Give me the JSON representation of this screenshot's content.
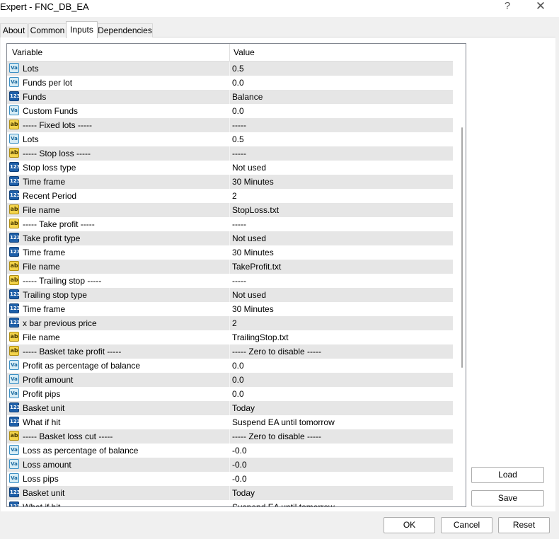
{
  "window": {
    "title": "Expert - FNC_DB_EA",
    "help": "?",
    "close": "✕"
  },
  "tabs": [
    {
      "label": "About"
    },
    {
      "label": "Common"
    },
    {
      "label": "Inputs"
    },
    {
      "label": "Dependencies"
    }
  ],
  "grid": {
    "headers": {
      "variable": "Variable",
      "value": "Value"
    },
    "rows": [
      {
        "type": "v",
        "variable": "Lots",
        "value": "0.5"
      },
      {
        "type": "v",
        "variable": "Funds per lot",
        "value": "0.0"
      },
      {
        "type": "n",
        "variable": "Funds",
        "value": "Balance"
      },
      {
        "type": "v",
        "variable": "Custom Funds",
        "value": "0.0"
      },
      {
        "type": "s",
        "variable": "----- Fixed lots -----",
        "value": "-----"
      },
      {
        "type": "v",
        "variable": "Lots",
        "value": "0.5"
      },
      {
        "type": "s",
        "variable": "----- Stop loss -----",
        "value": "-----"
      },
      {
        "type": "n",
        "variable": "Stop loss type",
        "value": "Not used"
      },
      {
        "type": "n",
        "variable": "Time frame",
        "value": "30 Minutes"
      },
      {
        "type": "n",
        "variable": "Recent Period",
        "value": "2"
      },
      {
        "type": "s",
        "variable": "File name",
        "value": "StopLoss.txt"
      },
      {
        "type": "s",
        "variable": "----- Take profit -----",
        "value": "-----"
      },
      {
        "type": "n",
        "variable": "Take profit type",
        "value": "Not used"
      },
      {
        "type": "n",
        "variable": "Time frame",
        "value": "30 Minutes"
      },
      {
        "type": "s",
        "variable": "File name",
        "value": "TakeProfit.txt"
      },
      {
        "type": "s",
        "variable": "----- Trailing stop -----",
        "value": "-----"
      },
      {
        "type": "n",
        "variable": "Trailing stop type",
        "value": "Not used"
      },
      {
        "type": "n",
        "variable": "Time frame",
        "value": "30 Minutes"
      },
      {
        "type": "n",
        "variable": "x bar previous price",
        "value": "2"
      },
      {
        "type": "s",
        "variable": "File name",
        "value": "TrailingStop.txt"
      },
      {
        "type": "s",
        "variable": "----- Basket take profit -----",
        "value": "----- Zero to disable -----"
      },
      {
        "type": "v",
        "variable": "Profit as percentage of balance",
        "value": "0.0"
      },
      {
        "type": "v",
        "variable": "Profit amount",
        "value": "0.0"
      },
      {
        "type": "v",
        "variable": "Profit pips",
        "value": "0.0"
      },
      {
        "type": "n",
        "variable": "Basket unit",
        "value": "Today"
      },
      {
        "type": "n",
        "variable": "What if hit",
        "value": "Suspend EA until tomorrow"
      },
      {
        "type": "s",
        "variable": "----- Basket loss cut -----",
        "value": "----- Zero to disable -----"
      },
      {
        "type": "v",
        "variable": "Loss as percentage of balance",
        "value": "-0.0"
      },
      {
        "type": "v",
        "variable": "Loss amount",
        "value": "-0.0"
      },
      {
        "type": "v",
        "variable": "Loss pips",
        "value": "-0.0"
      },
      {
        "type": "n",
        "variable": "Basket unit",
        "value": "Today"
      },
      {
        "type": "n",
        "variable": "What if hit",
        "value": "Suspend EA until tomorrow"
      }
    ]
  },
  "icons": {
    "v": {
      "name": "double-param-icon",
      "glyph": "Va"
    },
    "n": {
      "name": "enum-param-icon",
      "glyph": "123"
    },
    "s": {
      "name": "string-param-icon",
      "glyph": "ab"
    }
  },
  "buttons": {
    "load": "Load",
    "save": "Save",
    "ok": "OK",
    "cancel": "Cancel",
    "reset": "Reset"
  }
}
